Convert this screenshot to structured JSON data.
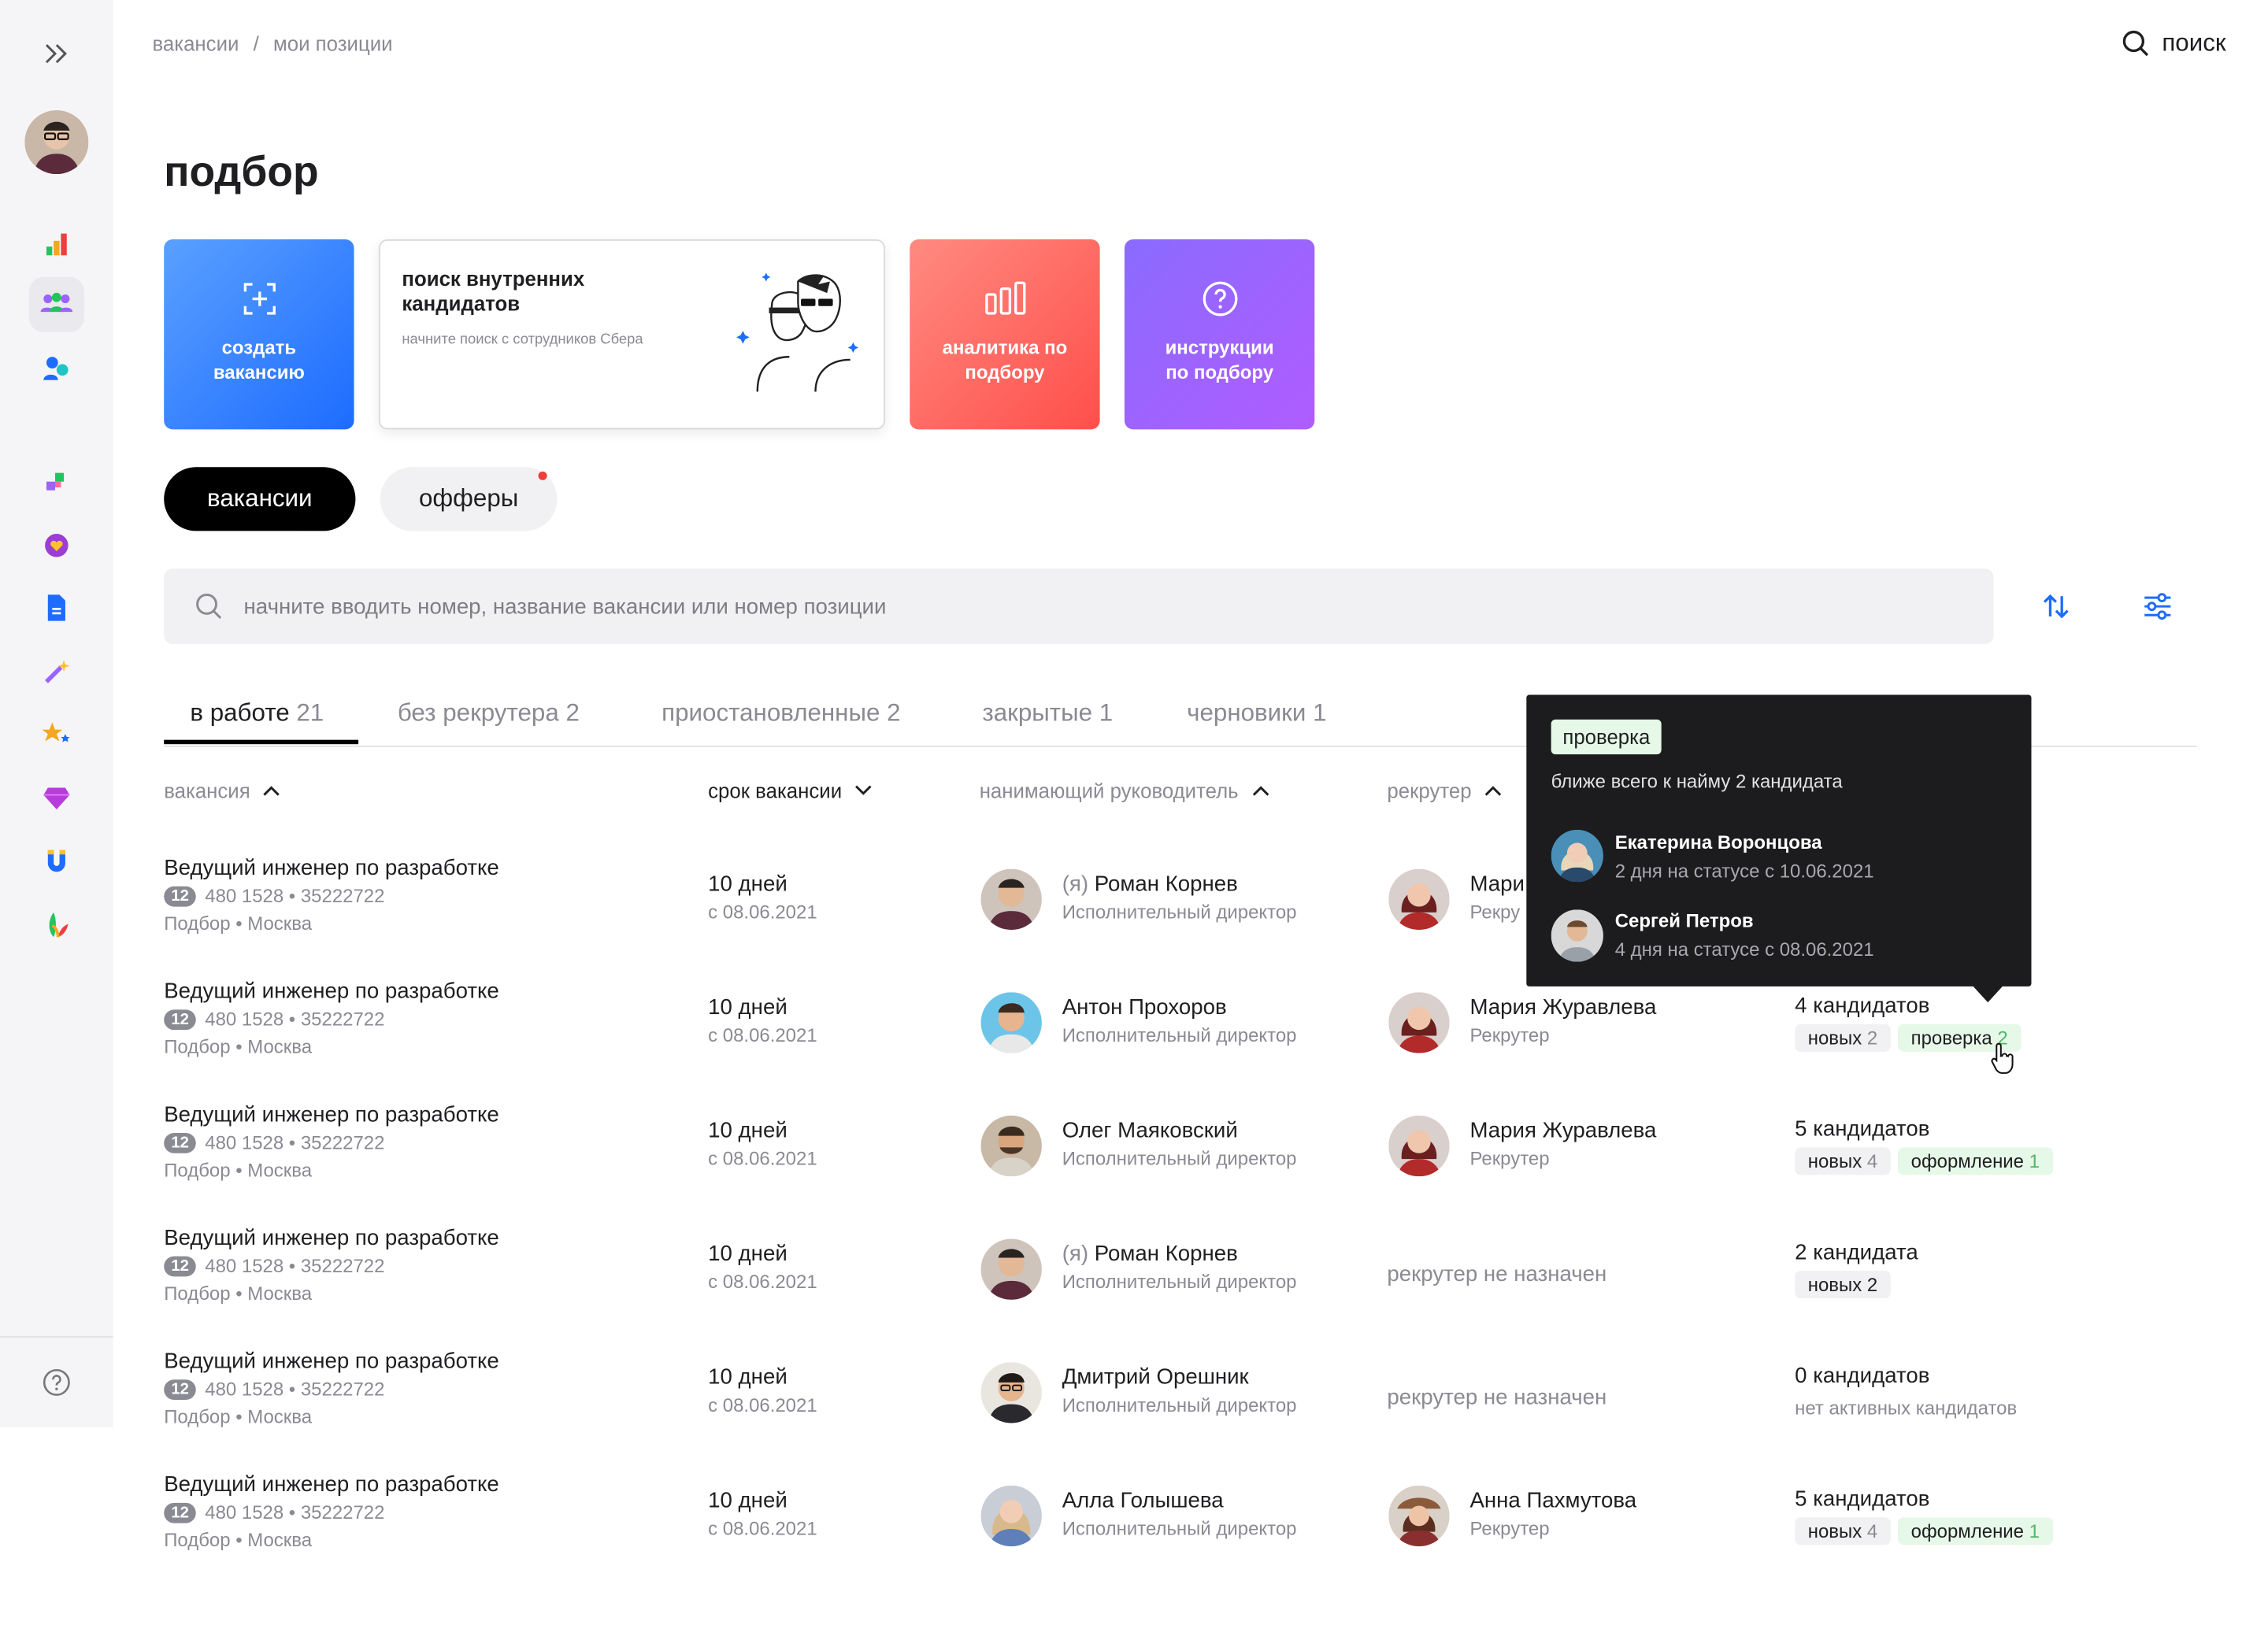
{
  "breadcrumb": [
    "вакансии",
    "/",
    "мои позиции"
  ],
  "header": {
    "search_label": "поиск"
  },
  "page_title": "подбор",
  "cards": {
    "create": "создать вакансию",
    "internal_title": "поиск внутренних кандидатов",
    "internal_sub": "начните поиск с сотрудников Сбера",
    "analytics": "аналитика по подбору",
    "instructions": "инструкции по подбору"
  },
  "segments": {
    "vacancies": "вакансии",
    "offers": "офферы"
  },
  "search": {
    "placeholder": "начните вводить номер, название вакансии или номер позиции"
  },
  "tabs": [
    {
      "label": "в работе",
      "count": "21"
    },
    {
      "label": "без рекрутера",
      "count": "2"
    },
    {
      "label": "приостановленные",
      "count": "2"
    },
    {
      "label": "закрытые",
      "count": "1"
    },
    {
      "label": "черновики",
      "count": "1"
    }
  ],
  "columns": {
    "vacancy": "вакансия",
    "term": "срок вакансии",
    "manager": "нанимающий руководитель",
    "recruiter": "рекрутер"
  },
  "rows": [
    {
      "title": "Ведущий инженер по разработке",
      "badge": "12",
      "ids": "480 1528 • 35222722",
      "location": "Подбор • Москва",
      "term": "10 дней",
      "term_since": "с 08.06.2021",
      "manager_prefix": "(я)",
      "manager": "Роман Корнев",
      "manager_role": "Исполнительный директор",
      "recruiter": "Мари",
      "recruiter_role": "Рекру"
    },
    {
      "title": "Ведущий инженер по разработке",
      "badge": "12",
      "ids": "480 1528 • 35222722",
      "location": "Подбор • Москва",
      "term": "10 дней",
      "term_since": "с 08.06.2021",
      "manager": "Антон Прохоров",
      "manager_role": "Исполнительный директор",
      "recruiter": "Мария Журавлева",
      "recruiter_role": "Рекрутер",
      "candidates": "4 кандидатов",
      "chip1": "новых",
      "chip1_count": "2",
      "chip2": "проверка",
      "chip2_count": "2"
    },
    {
      "title": "Ведущий инженер по разработке",
      "badge": "12",
      "ids": "480 1528 • 35222722",
      "location": "Подбор • Москва",
      "term": "10 дней",
      "term_since": "с 08.06.2021",
      "manager": "Олег Маяковский",
      "manager_role": "Исполнительный директор",
      "recruiter": "Мария Журавлева",
      "recruiter_role": "Рекрутер",
      "candidates": "5 кандидатов",
      "chip1": "новых",
      "chip1_count": "4",
      "chip2": "оформление",
      "chip2_count": "1"
    },
    {
      "title": "Ведущий инженер по разработке",
      "badge": "12",
      "ids": "480 1528 • 35222722",
      "location": "Подбор • Москва",
      "term": "10 дней",
      "term_since": "с 08.06.2021",
      "manager_prefix": "(я)",
      "manager": "Роман Корнев",
      "manager_role": "Исполнительный директор",
      "no_recruiter": "рекрутер не назначен",
      "candidates": "2 кандидата",
      "chip1": "новых",
      "chip1_count": "2"
    },
    {
      "title": "Ведущий инженер по разработке",
      "badge": "12",
      "ids": "480 1528 • 35222722",
      "location": "Подбор • Москва",
      "term": "10 дней",
      "term_since": "с 08.06.2021",
      "manager": "Дмитрий Орешник",
      "manager_role": "Исполнительный директор",
      "no_recruiter": "рекрутер не назначен",
      "candidates": "0 кандидатов",
      "no_active": "нет активных кандидатов"
    },
    {
      "title": "Ведущий инженер по разработке",
      "badge": "12",
      "ids": "480 1528 • 35222722",
      "location": "Подбор • Москва",
      "term": "10 дней",
      "term_since": "с 08.06.2021",
      "manager": "Алла Голышева",
      "manager_role": "Исполнительный директор",
      "recruiter": "Анна Пахмутова",
      "recruiter_role": "Рекрутер",
      "candidates": "5 кандидатов",
      "chip1": "новых",
      "chip1_count": "4",
      "chip2": "оформление",
      "chip2_count": "1"
    }
  ],
  "tooltip": {
    "badge": "проверка",
    "desc": "ближе всего к найму 2 кандидата",
    "people": [
      {
        "name": "Екатерина Воронцова",
        "status": "2 дня на статусе с 10.06.2021"
      },
      {
        "name": "Сергей Петров",
        "status": "4 дня на статусе с 08.06.2021"
      }
    ]
  },
  "icons": [
    "expand-icon",
    "analytics-icon",
    "team-icon",
    "people-icon",
    "puzzle-icon",
    "heart-icon",
    "document-icon",
    "magic-icon",
    "stars-icon",
    "diamond-icon",
    "magnet-icon",
    "leaf-icon",
    "help-icon",
    "search-icon",
    "sort-icon",
    "filter-icon"
  ],
  "colors": {
    "accent_blue": "#1d6cff",
    "accent_red": "#ff4f4b",
    "accent_purple": "#9b63ff",
    "status_green": "#e6f8e8",
    "notification_red": "#f03d3d"
  }
}
